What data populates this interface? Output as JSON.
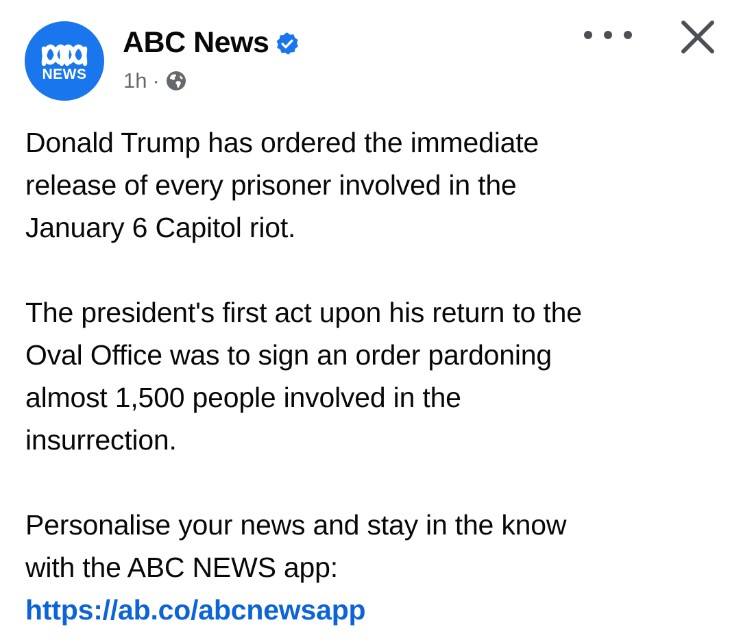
{
  "post": {
    "avatar": {
      "label": "NEWS",
      "icon": "abc-lissajous-logo-icon",
      "color": "#1a76ec"
    },
    "page_name": "ABC News",
    "verified_icon": "verified-badge-icon",
    "verified_color": "#1a76ec",
    "timestamp": "1h",
    "separator": "·",
    "audience_icon": "globe-icon",
    "more_icon": "more-options-icon",
    "close_icon": "close-icon"
  },
  "body": {
    "paragraphs": [
      {
        "lines": [
          "Donald Trump has ordered the immediate",
          "release of every prisoner involved in the",
          "January 6 Capitol riot."
        ]
      },
      {
        "lines": [
          "The president's first act upon his return to the",
          "Oval Office was to sign an order pardoning",
          "almost 1,500 people involved in the",
          "insurrection."
        ]
      },
      {
        "lines": [
          "Personalise your news and stay in the know",
          "with the ABC NEWS app:"
        ],
        "link": "https://ab.co/abcnewsapp"
      }
    ],
    "link_color": "#0c64d7"
  }
}
